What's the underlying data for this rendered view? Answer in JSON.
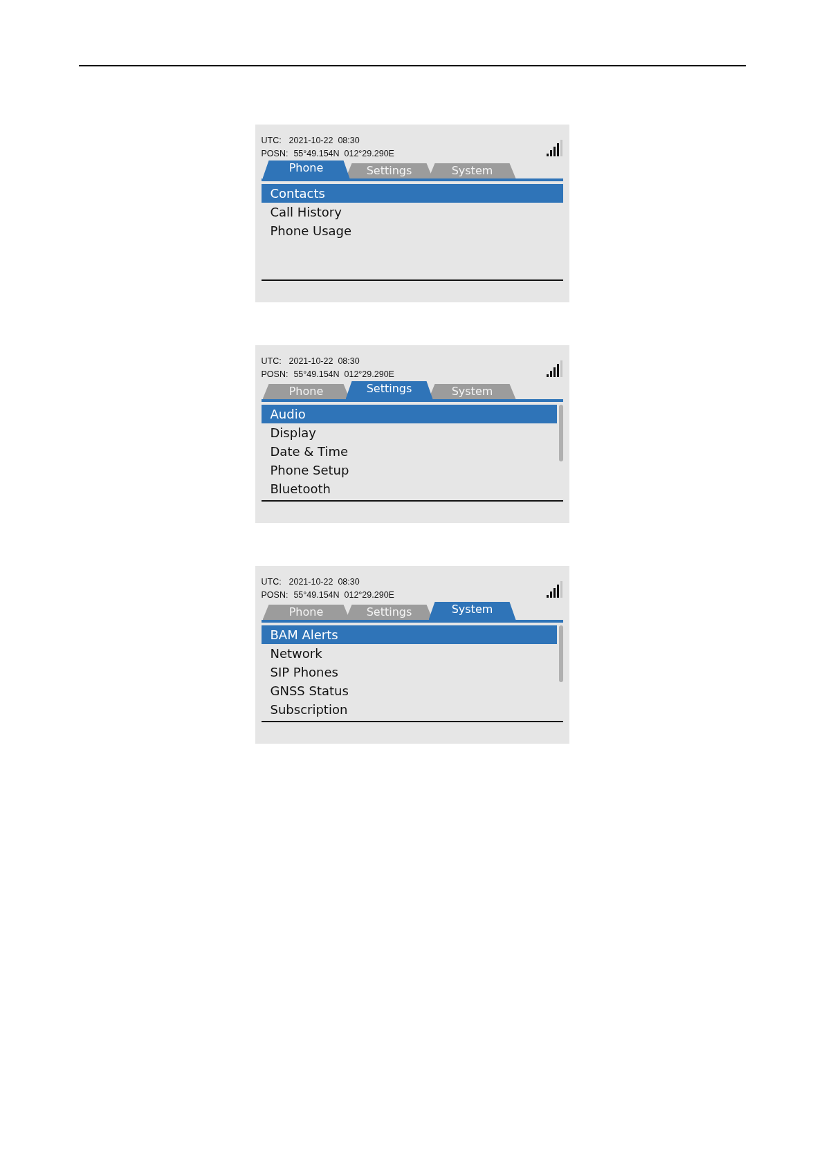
{
  "screens": [
    {
      "utc_label": "UTC:",
      "utc_value": "2021-10-22  08:30",
      "posn_label": "POSN:",
      "posn_value": "55°49.154N  012°29.290E",
      "scrollable": false,
      "tabs": [
        {
          "label": "Phone",
          "selected": true
        },
        {
          "label": "Settings",
          "selected": false
        },
        {
          "label": "System",
          "selected": false
        }
      ],
      "items": [
        {
          "label": "Contacts",
          "selected": true
        },
        {
          "label": "Call History",
          "selected": false
        },
        {
          "label": "Phone Usage",
          "selected": false
        }
      ]
    },
    {
      "utc_label": "UTC:",
      "utc_value": "2021-10-22  08:30",
      "posn_label": "POSN:",
      "posn_value": "55°49.154N  012°29.290E",
      "scrollable": true,
      "tabs": [
        {
          "label": "Phone",
          "selected": false
        },
        {
          "label": "Settings",
          "selected": true
        },
        {
          "label": "System",
          "selected": false
        }
      ],
      "items": [
        {
          "label": "Audio",
          "selected": true
        },
        {
          "label": "Display",
          "selected": false
        },
        {
          "label": "Date & Time",
          "selected": false
        },
        {
          "label": "Phone Setup",
          "selected": false
        },
        {
          "label": "Bluetooth",
          "selected": false
        }
      ]
    },
    {
      "utc_label": "UTC:",
      "utc_value": "2021-10-22  08:30",
      "posn_label": "POSN:",
      "posn_value": "55°49.154N  012°29.290E",
      "scrollable": true,
      "tabs": [
        {
          "label": "Phone",
          "selected": false
        },
        {
          "label": "Settings",
          "selected": false
        },
        {
          "label": "System",
          "selected": true
        }
      ],
      "items": [
        {
          "label": "BAM Alerts",
          "selected": true
        },
        {
          "label": "Network",
          "selected": false
        },
        {
          "label": "SIP Phones",
          "selected": false
        },
        {
          "label": "GNSS Status",
          "selected": false
        },
        {
          "label": "Subscription",
          "selected": false
        }
      ]
    }
  ]
}
